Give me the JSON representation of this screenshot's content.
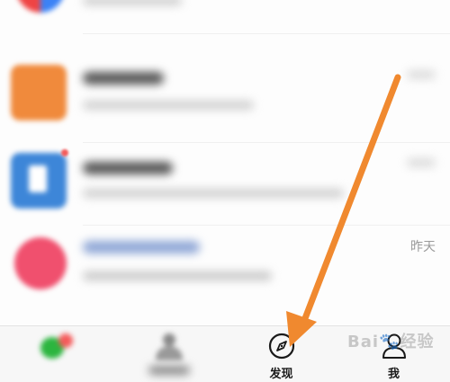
{
  "chat_list": {
    "items": [
      {
        "time": ""
      },
      {
        "time": ""
      },
      {
        "time": ""
      },
      {
        "time": "昨天"
      }
    ]
  },
  "tabbar": {
    "tabs": [
      {
        "label": ""
      },
      {
        "label": ""
      },
      {
        "label": "发现"
      },
      {
        "label": "我"
      }
    ]
  },
  "colors": {
    "arrow": "#f0892f",
    "tab_icon": "#1a1a1a",
    "badge": "#f45b5b"
  },
  "watermark": {
    "icons": [
      "baidu-jingyan-logo"
    ]
  }
}
